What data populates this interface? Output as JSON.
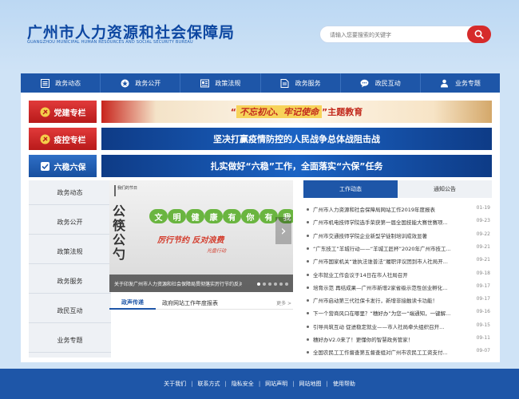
{
  "header": {
    "title": "广州市人力资源和社会保障局",
    "subtitle": "GUANGZHOU MUNICIPAL HUMAN RESOURCES AND SOCIAL SECURITY BUREAU",
    "search_placeholder": "请输入您要搜索的关键字",
    "search_icon": "search-icon"
  },
  "nav": [
    {
      "label": "政务动态",
      "icon": "list-icon"
    },
    {
      "label": "政务公开",
      "icon": "star-icon"
    },
    {
      "label": "政策法规",
      "icon": "book-icon"
    },
    {
      "label": "政务服务",
      "icon": "doc-icon"
    },
    {
      "label": "政民互动",
      "icon": "chat-icon"
    },
    {
      "label": "业务专题",
      "icon": "people-icon"
    }
  ],
  "banners": [
    {
      "tag": "党建专栏",
      "text_pre": "“",
      "text_highlight": "不忘初心、牢记使命",
      "text_post": "”主题教育"
    },
    {
      "tag": "疫控专栏",
      "text": "坚决打赢疫情防控的人民战争总体战阻击战"
    },
    {
      "tag": "六稳六保",
      "text": "扎实做好“六稳”工作，全面落实“六保”任务"
    }
  ],
  "sidebar": [
    "政务动态",
    "政务公开",
    "政策法规",
    "政务服务",
    "政民互动",
    "业务专题"
  ],
  "slider": {
    "box_text": "我们的节日",
    "slogan1": [
      "文",
      "明",
      "健",
      "康",
      "有",
      "你",
      "有",
      "我"
    ],
    "slogan2": "厉行节约  反对浪费",
    "slogan3": "光盘行动",
    "caption": "关于印发广州市人力资源和社会保障局贯彻落实厉行节约反对浪费和息...",
    "chop_text": "公筷公勺",
    "dots": 6,
    "active_dot": 0
  },
  "mini_tabs": {
    "active": "政声传递",
    "other": "政府网站工作年度报表",
    "more": "更多 >"
  },
  "news": {
    "tabs": [
      "工作动态",
      "通知公告"
    ],
    "items": [
      {
        "title": "广州市人力资源和社会保障局网站工作2019年度报表",
        "date": "01-19"
      },
      {
        "title": "广州市机电技师学院选手荣获第一届全国技能大赛世赛项...",
        "date": "09-23"
      },
      {
        "title": "广州市交通技师学院企业新型学徒制培训成效显著",
        "date": "09-22"
      },
      {
        "title": "“广东技工”羊城行动——“羊城工匠杯”2020年广州市技工...",
        "date": "09-21"
      },
      {
        "title": "广州市国家机关“谁执法谁普法”履职评议团到市人社局开...",
        "date": "09-21"
      },
      {
        "title": "全市就业工作会议于14日在市人社局召开",
        "date": "09-18"
      },
      {
        "title": "培育示范 再结成果—广州市新增2家省级示范性创业孵化...",
        "date": "09-17"
      },
      {
        "title": "广州市启动第三代社保卡发行，新增非接触读卡功能！",
        "date": "09-17"
      },
      {
        "title": "下一个营商风口在哪里？“穗好办”为您一“端通知，一键解...",
        "date": "09-16"
      },
      {
        "title": "引导共筑互动 促进稳定就业——市人社局牵头组织召开...",
        "date": "09-15"
      },
      {
        "title": "穗好办V2.0来了！更懂你的智慧政务管家！",
        "date": "09-11"
      },
      {
        "title": "全国农民工工作督查第五督查组对广州市农民工工资支付...",
        "date": "09-07"
      }
    ]
  },
  "footer": [
    "关于我们",
    "联系方式",
    "隐私安全",
    "网站声明",
    "网站地图",
    "使用帮助"
  ],
  "colors": {
    "primary": "#1e56a8",
    "accent_red": "#d62b2b",
    "bg": "#cfe3f6"
  }
}
